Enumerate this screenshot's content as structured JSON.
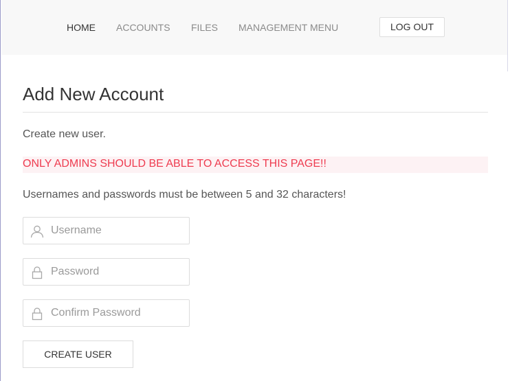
{
  "nav": {
    "links": [
      {
        "label": "HOME",
        "active": true
      },
      {
        "label": "ACCOUNTS",
        "active": false
      },
      {
        "label": "FILES",
        "active": false
      },
      {
        "label": "MANAGEMENT MENU",
        "active": false
      }
    ],
    "logout_label": "LOG OUT"
  },
  "page": {
    "title": "Add New Account",
    "intro": "Create new user.",
    "warning": "ONLY ADMINS SHOULD BE ABLE TO ACCESS THIS PAGE!!",
    "rules": "Usernames and passwords must be between 5 and 32 characters!"
  },
  "form": {
    "username": {
      "placeholder": "Username",
      "value": "",
      "icon": "user-icon"
    },
    "password": {
      "placeholder": "Password",
      "value": "",
      "icon": "lock-icon"
    },
    "confirm_password": {
      "placeholder": "Confirm Password",
      "value": "",
      "icon": "lock-icon"
    },
    "submit_label": "CREATE USER"
  },
  "colors": {
    "navbar_bg": "#f8f8f8",
    "warning_text": "#ee3b4f",
    "warning_bg": "#fdf2f4",
    "active_nav": "#333333",
    "inactive_nav": "#8a8a8a"
  }
}
